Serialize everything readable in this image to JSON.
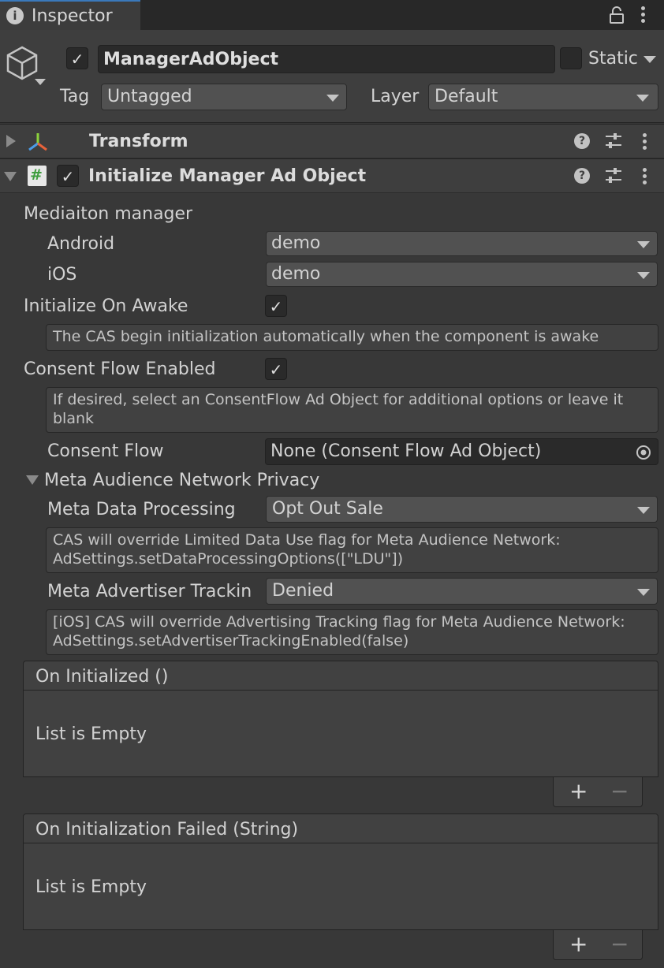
{
  "tab": {
    "label": "Inspector"
  },
  "object": {
    "name": "ManagerAdObject",
    "static_label": "Static",
    "tag_label": "Tag",
    "tag_value": "Untagged",
    "layer_label": "Layer",
    "layer_value": "Default"
  },
  "components": {
    "transform": {
      "title": "Transform"
    },
    "script": {
      "title": "Initialize Manager Ad Object"
    }
  },
  "fields": {
    "mediation_header": "Mediaiton manager",
    "android_label": "Android",
    "android_value": "demo",
    "ios_label": "iOS",
    "ios_value": "demo",
    "init_on_awake_label": "Initialize On Awake",
    "init_help": "The CAS begin initialization automatically when the component is awake",
    "consent_enabled_label": "Consent Flow Enabled",
    "consent_help": "If desired, select an ConsentFlow Ad Object for additional options or leave it blank",
    "consent_flow_label": "Consent Flow",
    "consent_flow_value": "None (Consent Flow Ad Object)",
    "meta_section": "Meta Audience Network Privacy",
    "meta_processing_label": "Meta Data Processing",
    "meta_processing_value": "Opt Out Sale",
    "meta_processing_help": "CAS will override Limited Data Use flag for Meta Audience Network: AdSettings.setDataProcessingOptions([\"LDU\"])",
    "meta_tracking_label": "Meta Advertiser Trackin",
    "meta_tracking_value": "Denied",
    "meta_tracking_help": "[iOS] CAS will override Advertising Tracking flag for Meta Audience Network: AdSettings.setAdvertiserTrackingEnabled(false)"
  },
  "events": [
    {
      "title": "On Initialized ()",
      "empty_text": "List is Empty"
    },
    {
      "title": "On Initialization Failed (String)",
      "empty_text": "List is Empty"
    }
  ],
  "symbols": {
    "check": "✓",
    "plus": "+",
    "minus": "−",
    "hash": "#",
    "info": "i",
    "question": "?"
  },
  "colors": {
    "background": "#383838",
    "tab_accent": "#3a79bb",
    "script_icon": "#4caf50"
  }
}
